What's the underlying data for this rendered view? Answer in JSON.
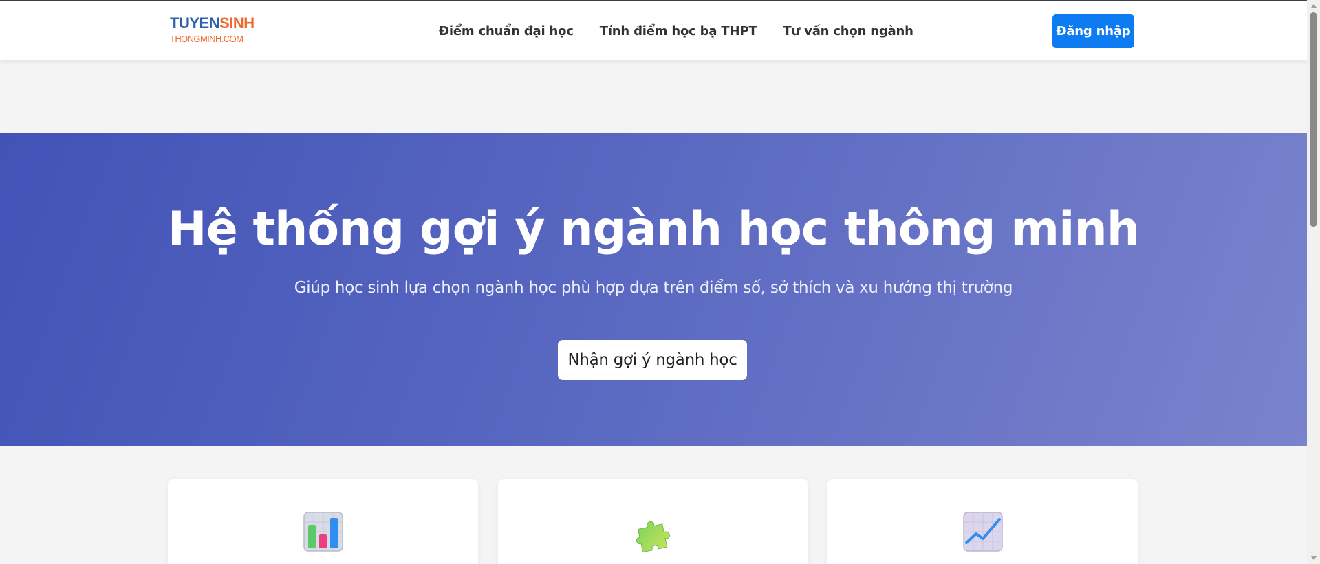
{
  "brand": {
    "logo_top_main": "TUYEN",
    "logo_top_accent": "SINH",
    "logo_bottom": "THONGMINH.COM",
    "colors": {
      "blue": "#2f5fa8",
      "orange": "#f0672a"
    }
  },
  "nav": {
    "links": [
      {
        "label": "Điểm chuẩn đại học"
      },
      {
        "label": "Tính điểm học bạ THPT"
      },
      {
        "label": "Tư vấn chọn ngành"
      }
    ],
    "login_label": "Đăng nhập",
    "login_color": "#0d7cf2"
  },
  "hero": {
    "title": "Hệ thống gợi ý ngành học thông minh",
    "subtitle": "Giúp học sinh lựa chọn ngành học phù hợp dựa trên điểm số, sở thích và xu hướng thị trường",
    "cta_label": "Nhận gợi ý ngành học",
    "gradient": [
      "#4253b7",
      "#7a83cc"
    ]
  },
  "features": [
    {
      "icon": "bar-chart-icon"
    },
    {
      "icon": "puzzle-piece-icon"
    },
    {
      "icon": "trending-chart-icon"
    }
  ]
}
